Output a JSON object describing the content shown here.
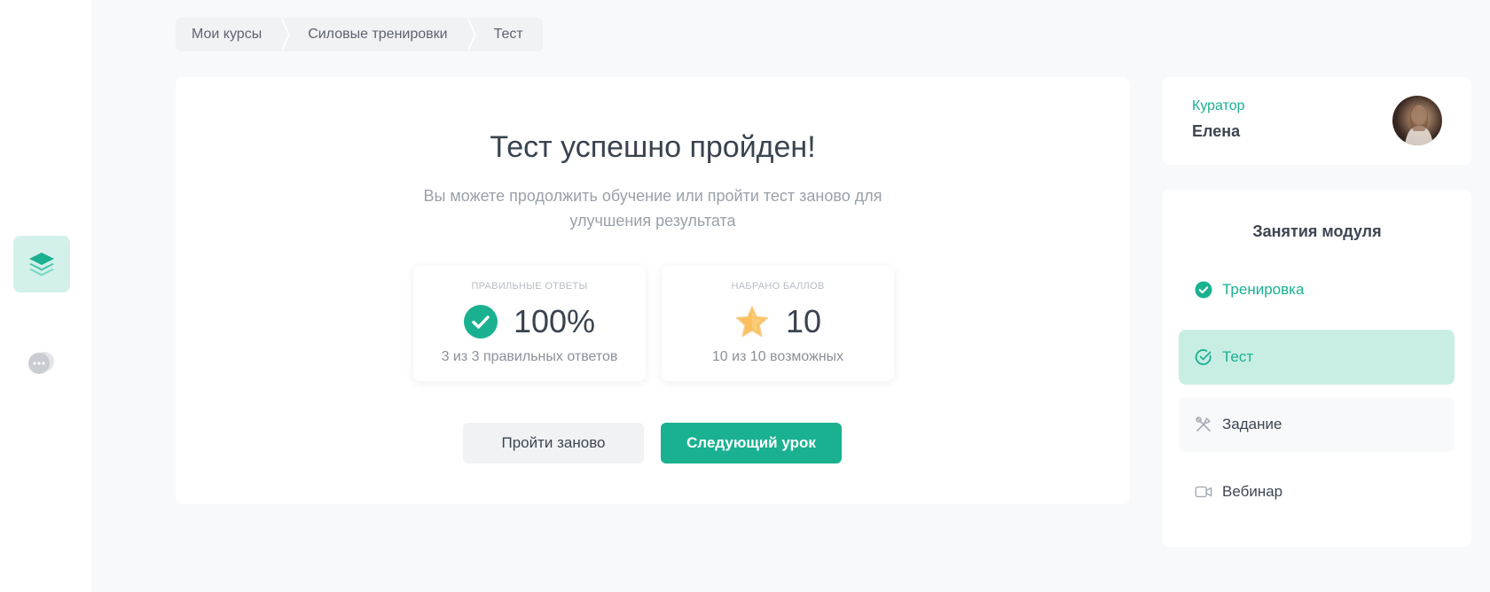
{
  "breadcrumb": [
    "Мои курсы",
    "Силовые тренировки",
    "Тест"
  ],
  "result": {
    "title": "Тест успешно пройден!",
    "subtitle": "Вы можете продолжить обучение или пройти тест заново для улучшения результата",
    "correct": {
      "label": "ПРАВИЛЬНЫЕ ОТВЕТЫ",
      "value": "100%",
      "foot": "3 из 3 правильных ответов",
      "icon": "check-circle-icon"
    },
    "score": {
      "label": "НАБРАНО БАЛЛОВ",
      "value": "10",
      "foot": "10 из 10 возможных",
      "icon": "star-icon"
    },
    "retry_label": "Пройти заново",
    "next_label": "Следующий урок"
  },
  "curator": {
    "label": "Куратор",
    "name": "Елена"
  },
  "module": {
    "title": "Занятия модуля",
    "items": [
      {
        "label": "Тренировка",
        "icon": "check-filled-icon",
        "state": "done"
      },
      {
        "label": "Тест",
        "icon": "check-outline-icon",
        "state": "active"
      },
      {
        "label": "Задание",
        "icon": "tools-icon",
        "state": "default"
      },
      {
        "label": "Вебинар",
        "icon": "video-icon",
        "state": "default"
      }
    ]
  },
  "colors": {
    "accent": "#1ab191",
    "accent_light": "#c8eee4",
    "text": "#3d4552",
    "muted": "#9aa1ab"
  }
}
